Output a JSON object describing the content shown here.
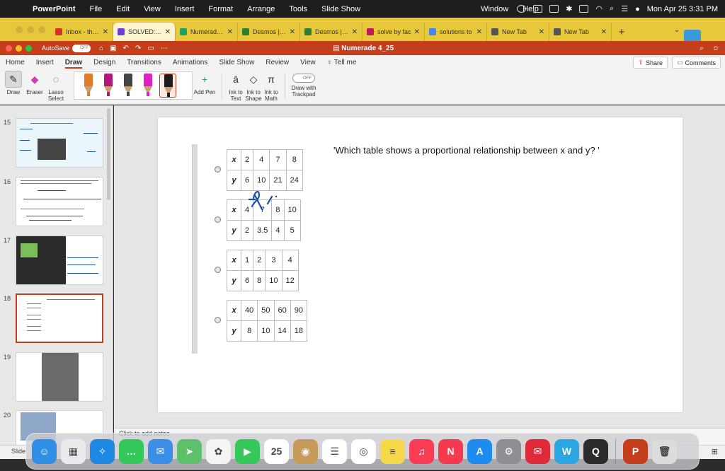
{
  "menubar": {
    "app_name": "PowerPoint",
    "items": [
      "File",
      "Edit",
      "View",
      "Insert",
      "Format",
      "Arrange",
      "Tools",
      "Slide Show"
    ],
    "window_label": "Window",
    "help_label": "Help",
    "datetime": "Mon Apr 25  3:31 PM"
  },
  "browser_tabs": [
    {
      "label": "Inbox - them",
      "favicon_color": "#d93025",
      "icon": "gmail-icon"
    },
    {
      "label": "SOLVED:' H",
      "favicon_color": "#6b3fd4",
      "icon": "numerade-icon"
    },
    {
      "label": "Numerade s",
      "favicon_color": "#1aa260",
      "icon": "sheets-icon"
    },
    {
      "label": "Desmos | Sc",
      "favicon_color": "#2e7d32",
      "icon": "desmos-icon"
    },
    {
      "label": "Desmos | Gr",
      "favicon_color": "#2e7d32",
      "icon": "desmos-icon"
    },
    {
      "label": "solve by fac",
      "favicon_color": "#c2185b",
      "icon": "symbolab-icon"
    },
    {
      "label": "solutions to",
      "favicon_color": "#4285f4",
      "icon": "google-icon"
    },
    {
      "label": "New Tab",
      "favicon_color": "#555555",
      "icon": "chrome-icon"
    },
    {
      "label": "New Tab",
      "favicon_color": "#555555",
      "icon": "chrome-icon"
    }
  ],
  "titlebar": {
    "autosave_label": "AutoSave",
    "autosave_state": "OFF",
    "document_title": "Numerade 4_25"
  },
  "ribbon": {
    "tabs": [
      "Home",
      "Insert",
      "Draw",
      "Design",
      "Transitions",
      "Animations",
      "Slide Show",
      "Review",
      "View"
    ],
    "active_tab": "Draw",
    "tell_me": "Tell me",
    "share_label": "Share",
    "comments_label": "Comments",
    "tools": {
      "draw": "Draw",
      "eraser": "Eraser",
      "lasso": "Lasso Select",
      "add_pen": "Add Pen",
      "ink_text": "Ink to Text",
      "ink_shape": "Ink to Shape",
      "ink_math": "Ink to Math",
      "trackpad": "Draw with Trackpad",
      "trackpad_state": "OFF"
    },
    "pen_colors": [
      "#e07b2a",
      "#b3177a",
      "#444444",
      "#e020c8",
      "#1d1d1d"
    ]
  },
  "slides": {
    "numbers": [
      "15",
      "16",
      "17",
      "18",
      "19",
      "20"
    ],
    "selected": "18"
  },
  "slide": {
    "question": "'Which table shows a proportional relationship between x and y? '",
    "tables": [
      {
        "x_label": "x",
        "y_label": "y",
        "x": [
          "2",
          "4",
          "7",
          "8"
        ],
        "y": [
          "6",
          "10",
          "21",
          "24"
        ]
      },
      {
        "x_label": "x",
        "y_label": "y",
        "x": [
          "4",
          "7",
          "8",
          "10"
        ],
        "y": [
          "2",
          "3.5",
          "4",
          "5"
        ]
      },
      {
        "x_label": "x",
        "y_label": "y",
        "x": [
          "1",
          "2",
          "3",
          "4"
        ],
        "y": [
          "6",
          "8",
          "10",
          "12"
        ]
      },
      {
        "x_label": "x",
        "y_label": "y",
        "x": [
          "40",
          "50",
          "60",
          "90"
        ],
        "y": [
          "8",
          "10",
          "14",
          "18"
        ]
      }
    ]
  },
  "notes_placeholder": "Click to add notes",
  "status": {
    "left": "Slide"
  },
  "dock": [
    {
      "name": "finder-icon",
      "color": "#2f8fe6",
      "glyph": "☺"
    },
    {
      "name": "launchpad-icon",
      "color": "#e9e9ee",
      "glyph": "▦"
    },
    {
      "name": "safari-icon",
      "color": "#1e88e5",
      "glyph": "✧"
    },
    {
      "name": "messages-icon",
      "color": "#34c759",
      "glyph": "…"
    },
    {
      "name": "mail-icon",
      "color": "#3a8ee6",
      "glyph": "✉"
    },
    {
      "name": "maps-icon",
      "color": "#5cc16a",
      "glyph": "➤"
    },
    {
      "name": "photos-icon",
      "color": "#f4f4f4",
      "glyph": "✿"
    },
    {
      "name": "facetime-icon",
      "color": "#34c759",
      "glyph": "▶"
    },
    {
      "name": "calendar-icon",
      "color": "#ffffff",
      "glyph": "25"
    },
    {
      "name": "contacts-icon",
      "color": "#c79a5a",
      "glyph": "◉"
    },
    {
      "name": "reminders-icon",
      "color": "#ffffff",
      "glyph": "☰"
    },
    {
      "name": "chrome-icon",
      "color": "#ffffff",
      "glyph": "◎"
    },
    {
      "name": "notes-icon",
      "color": "#f7d74a",
      "glyph": "≡"
    },
    {
      "name": "music-icon",
      "color": "#fa3c55",
      "glyph": "♫"
    },
    {
      "name": "news-icon",
      "color": "#f53a4f",
      "glyph": "N"
    },
    {
      "name": "appstore-icon",
      "color": "#1c8cf0",
      "glyph": "A"
    },
    {
      "name": "settings-icon",
      "color": "#8e8e93",
      "glyph": "⚙"
    },
    {
      "name": "email-app-icon",
      "color": "#e02a3a",
      "glyph": "✉"
    },
    {
      "name": "numerade-app-icon",
      "color": "#2aa7e0",
      "glyph": "W"
    },
    {
      "name": "quicktime-icon",
      "color": "#2b2b2b",
      "glyph": "Q"
    },
    {
      "name": "powerpoint-icon",
      "color": "#c43e1c",
      "glyph": "P"
    },
    {
      "name": "trash-icon",
      "color": "#dcdcdc",
      "glyph": "🗑"
    }
  ]
}
